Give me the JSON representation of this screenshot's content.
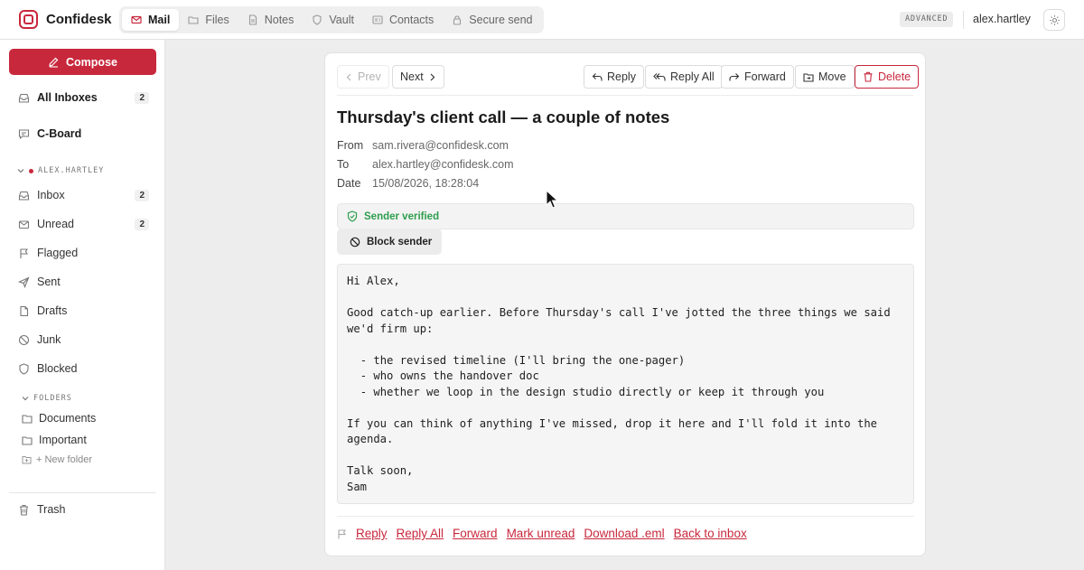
{
  "app": {
    "name": "Confidesk",
    "tier_badge": "ADVANCED",
    "username": "alex.hartley",
    "accent_color": "#c8283c"
  },
  "nav": {
    "tabs": [
      {
        "label": "Mail",
        "icon": "mail-icon",
        "active": true
      },
      {
        "label": "Files",
        "icon": "folder-icon",
        "active": false
      },
      {
        "label": "Notes",
        "icon": "note-icon",
        "active": false
      },
      {
        "label": "Vault",
        "icon": "shield-icon",
        "active": false
      },
      {
        "label": "Contacts",
        "icon": "contacts-icon",
        "active": false
      },
      {
        "label": "Secure send",
        "icon": "lock-icon",
        "active": false
      }
    ]
  },
  "sidebar": {
    "compose_label": "Compose",
    "all_inboxes": {
      "label": "All Inboxes",
      "count": "2"
    },
    "cboard": {
      "label": "C-Board"
    },
    "account_label": "ALEX.HARTLEY",
    "items": [
      {
        "label": "Inbox",
        "count": "2",
        "icon": "inbox-icon"
      },
      {
        "label": "Unread",
        "count": "2",
        "icon": "mail-icon"
      },
      {
        "label": "Flagged",
        "count": "",
        "icon": "flag-icon"
      },
      {
        "label": "Sent",
        "count": "",
        "icon": "send-icon"
      },
      {
        "label": "Drafts",
        "count": "",
        "icon": "draft-icon"
      },
      {
        "label": "Junk",
        "count": "",
        "icon": "junk-icon"
      },
      {
        "label": "Blocked",
        "count": "",
        "icon": "shield-icon"
      }
    ],
    "folders_label": "FOLDERS",
    "folders": [
      {
        "label": "Documents"
      },
      {
        "label": "Important"
      }
    ],
    "new_folder_label": "+ New folder",
    "trash_label": "Trash"
  },
  "message": {
    "toolbar": {
      "prev": "Prev",
      "next": "Next",
      "reply": "Reply",
      "reply_all": "Reply All",
      "forward": "Forward",
      "move": "Move",
      "delete": "Delete"
    },
    "subject": "Thursday's client call — a couple of notes",
    "from_label": "From",
    "from": "sam.rivera@confidesk.com",
    "to_label": "To",
    "to": "alex.hartley@confidesk.com",
    "date_label": "Date",
    "date": "15/08/2026, 18:28:04",
    "verified_label": "Sender verified",
    "block_label": "Block sender",
    "body": "Hi Alex,\n\nGood catch-up earlier. Before Thursday's call I've jotted the three things we said we'd firm up:\n\n  - the revised timeline (I'll bring the one-pager)\n  - who owns the handover doc\n  - whether we loop in the design studio directly or keep it through you\n\nIf you can think of anything I've missed, drop it here and I'll fold it into the agenda.\n\nTalk soon,\nSam",
    "footer_links": {
      "reply": "Reply",
      "reply_all": "Reply All",
      "forward": "Forward",
      "mark_unread": "Mark unread",
      "download": "Download .eml",
      "back": "Back to inbox"
    }
  }
}
